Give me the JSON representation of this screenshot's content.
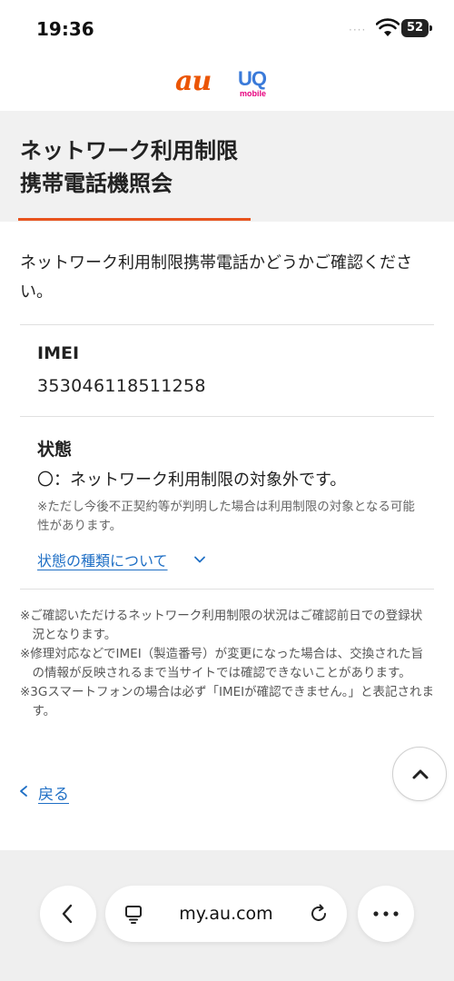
{
  "status_bar": {
    "time": "19:36",
    "signal": "····",
    "battery": "52"
  },
  "brand": {
    "au_logo": "au",
    "uq_logo": "UQ",
    "uq_sub": "mobile",
    "au_color": "#eb5505",
    "uq_color": "#3a7ad9"
  },
  "page": {
    "title": "ネットワーク利用制限\n携帯電話機照会",
    "intro": "ネットワーク利用制限携帯電話かどうかご確認ください。"
  },
  "imei": {
    "label": "IMEI",
    "value": "353046118511258"
  },
  "status": {
    "label": "状態",
    "result": "〇：ネットワーク利用制限の対象外です。",
    "note": "※ただし今後不正契約等が判明した場合は利用制限の対象となる可能性があります。",
    "link": "状態の種類について"
  },
  "notes": [
    "※ご確認いただけるネットワーク利用制限の状況はご確認前日での登録状況となります。",
    "※修理対応などでIMEI（製造番号）が変更になった場合は、交換された旨の情報が反映されるまで当サイトでは確認できないことがあります。",
    "※3Gスマートフォンの場合は必ず「IMEIが確認できません。」と表記されます。"
  ],
  "nav": {
    "back_label": "戻る"
  },
  "browser": {
    "url": "my.au.com"
  },
  "colors": {
    "accent": "#e8531d",
    "link": "#1f6fc5"
  }
}
